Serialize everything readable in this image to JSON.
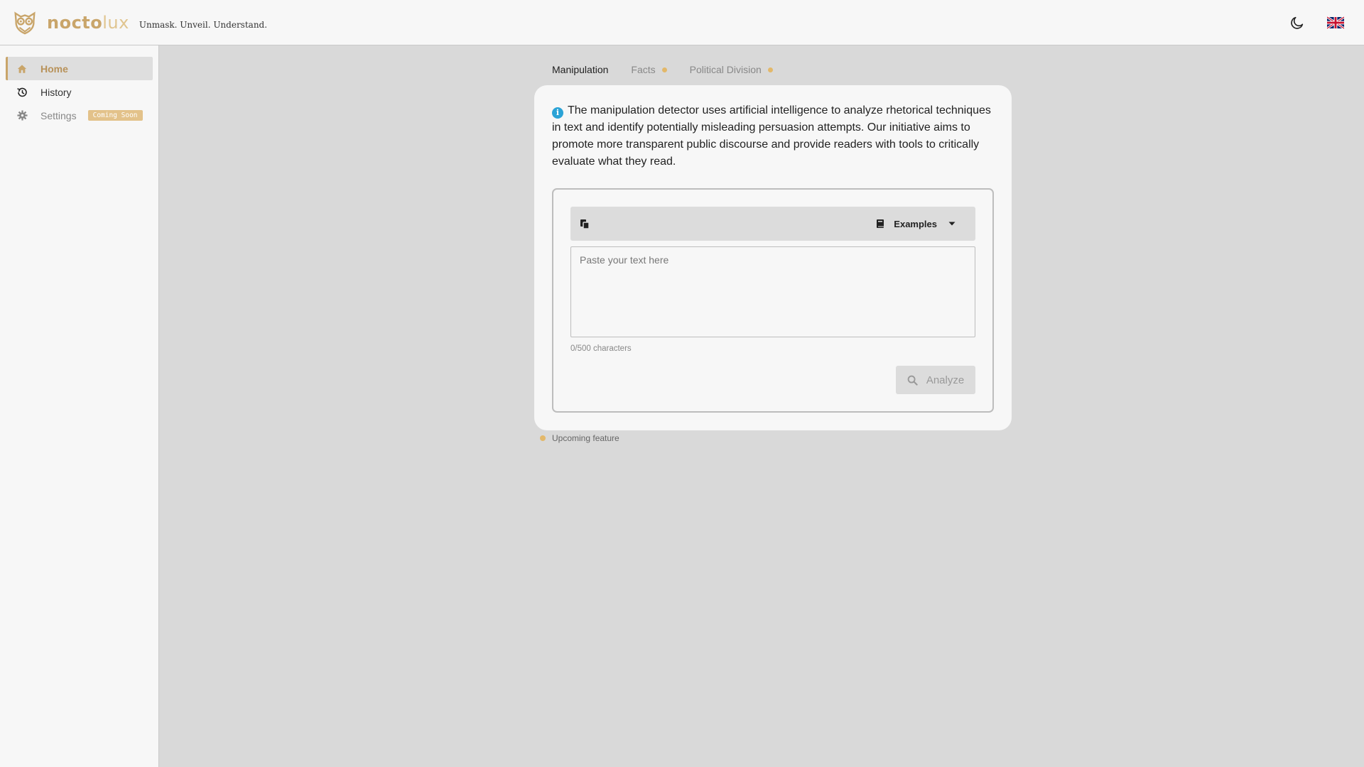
{
  "brand": {
    "name_part1": "nocto",
    "name_part2": "lux",
    "tagline": "Unmask. Unveil. Understand."
  },
  "header": {
    "theme_icon": "moon-icon",
    "language_icon": "uk-flag-icon"
  },
  "sidebar": {
    "items": [
      {
        "label": "Home",
        "icon": "home-icon",
        "active": true
      },
      {
        "label": "History",
        "icon": "history-icon",
        "active": false
      },
      {
        "label": "Settings",
        "icon": "gear-icon",
        "active": false,
        "badge": "Coming Soon"
      }
    ]
  },
  "tabs": [
    {
      "label": "Manipulation",
      "active": true,
      "upcoming": false
    },
    {
      "label": "Facts",
      "active": false,
      "upcoming": true
    },
    {
      "label": "Political Division",
      "active": false,
      "upcoming": true
    }
  ],
  "intro": {
    "text": "The manipulation detector uses artificial intelligence to analyze rhetorical techniques in text and identify potentially misleading persuasion attempts. Our initiative aims to promote more transparent public discourse and provide readers with tools to critically evaluate what they read."
  },
  "editor": {
    "examples_label": "Examples",
    "placeholder": "Paste your text here",
    "value": "",
    "counter": "0/500 characters",
    "analyze_label": "Analyze"
  },
  "legend": {
    "label": "Upcoming feature"
  },
  "colors": {
    "accent": "#c9a56a",
    "upcoming_dot": "#e3b86a",
    "info": "#2ba3d6"
  }
}
